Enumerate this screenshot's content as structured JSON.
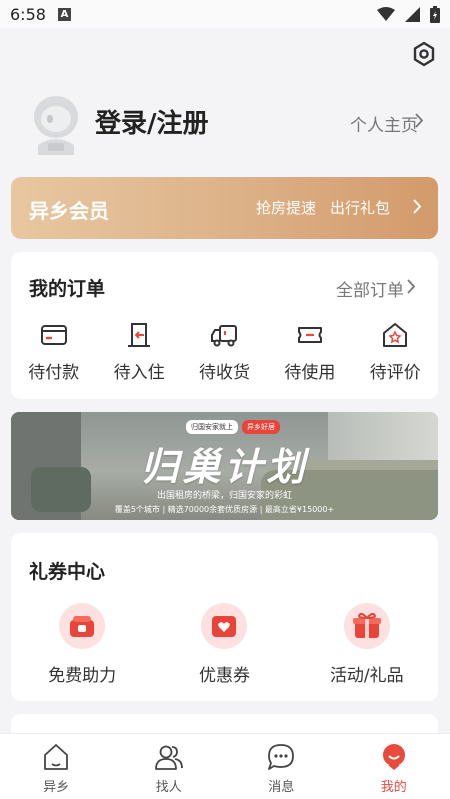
{
  "status_bar": {
    "time": "6:58",
    "notification_letter": "A"
  },
  "profile": {
    "login_label": "登录/注册",
    "homepage_label": "个人主页"
  },
  "vip": {
    "title": "异乡会员",
    "links": [
      "抢房提速",
      "出行礼包"
    ]
  },
  "orders": {
    "title": "我的订单",
    "all_label": "全部订单",
    "items": [
      {
        "label": "待付款",
        "icon": "card-icon"
      },
      {
        "label": "待入住",
        "icon": "door-checkin-icon"
      },
      {
        "label": "待收货",
        "icon": "truck-icon"
      },
      {
        "label": "待使用",
        "icon": "ticket-icon"
      },
      {
        "label": "待评价",
        "icon": "house-star-icon"
      }
    ]
  },
  "banner": {
    "tag1": "归国安家就上",
    "tag2": "异乡好居",
    "title": "归巢计划",
    "subtitle": "出国租房的桥梁，归国安家的彩虹",
    "details": "覆盖5个城市 | 精选70000余套优质房源 | 最高立省¥15000+"
  },
  "coupons": {
    "title": "礼券中心",
    "items": [
      {
        "label": "免费助力",
        "icon": "gift-box-icon"
      },
      {
        "label": "优惠券",
        "icon": "coupon-heart-icon"
      },
      {
        "label": "活动/礼品",
        "icon": "present-icon"
      }
    ]
  },
  "tabs": [
    {
      "label": "异乡",
      "icon": "home-icon",
      "active": false
    },
    {
      "label": "找人",
      "icon": "people-icon",
      "active": false
    },
    {
      "label": "消息",
      "icon": "chat-icon",
      "active": false
    },
    {
      "label": "我的",
      "icon": "profile-face-icon",
      "active": true
    }
  ],
  "colors": {
    "accent": "#e84a3c",
    "vip_gradient_start": "#e8c7a1",
    "vip_gradient_end": "#d39a6a"
  }
}
